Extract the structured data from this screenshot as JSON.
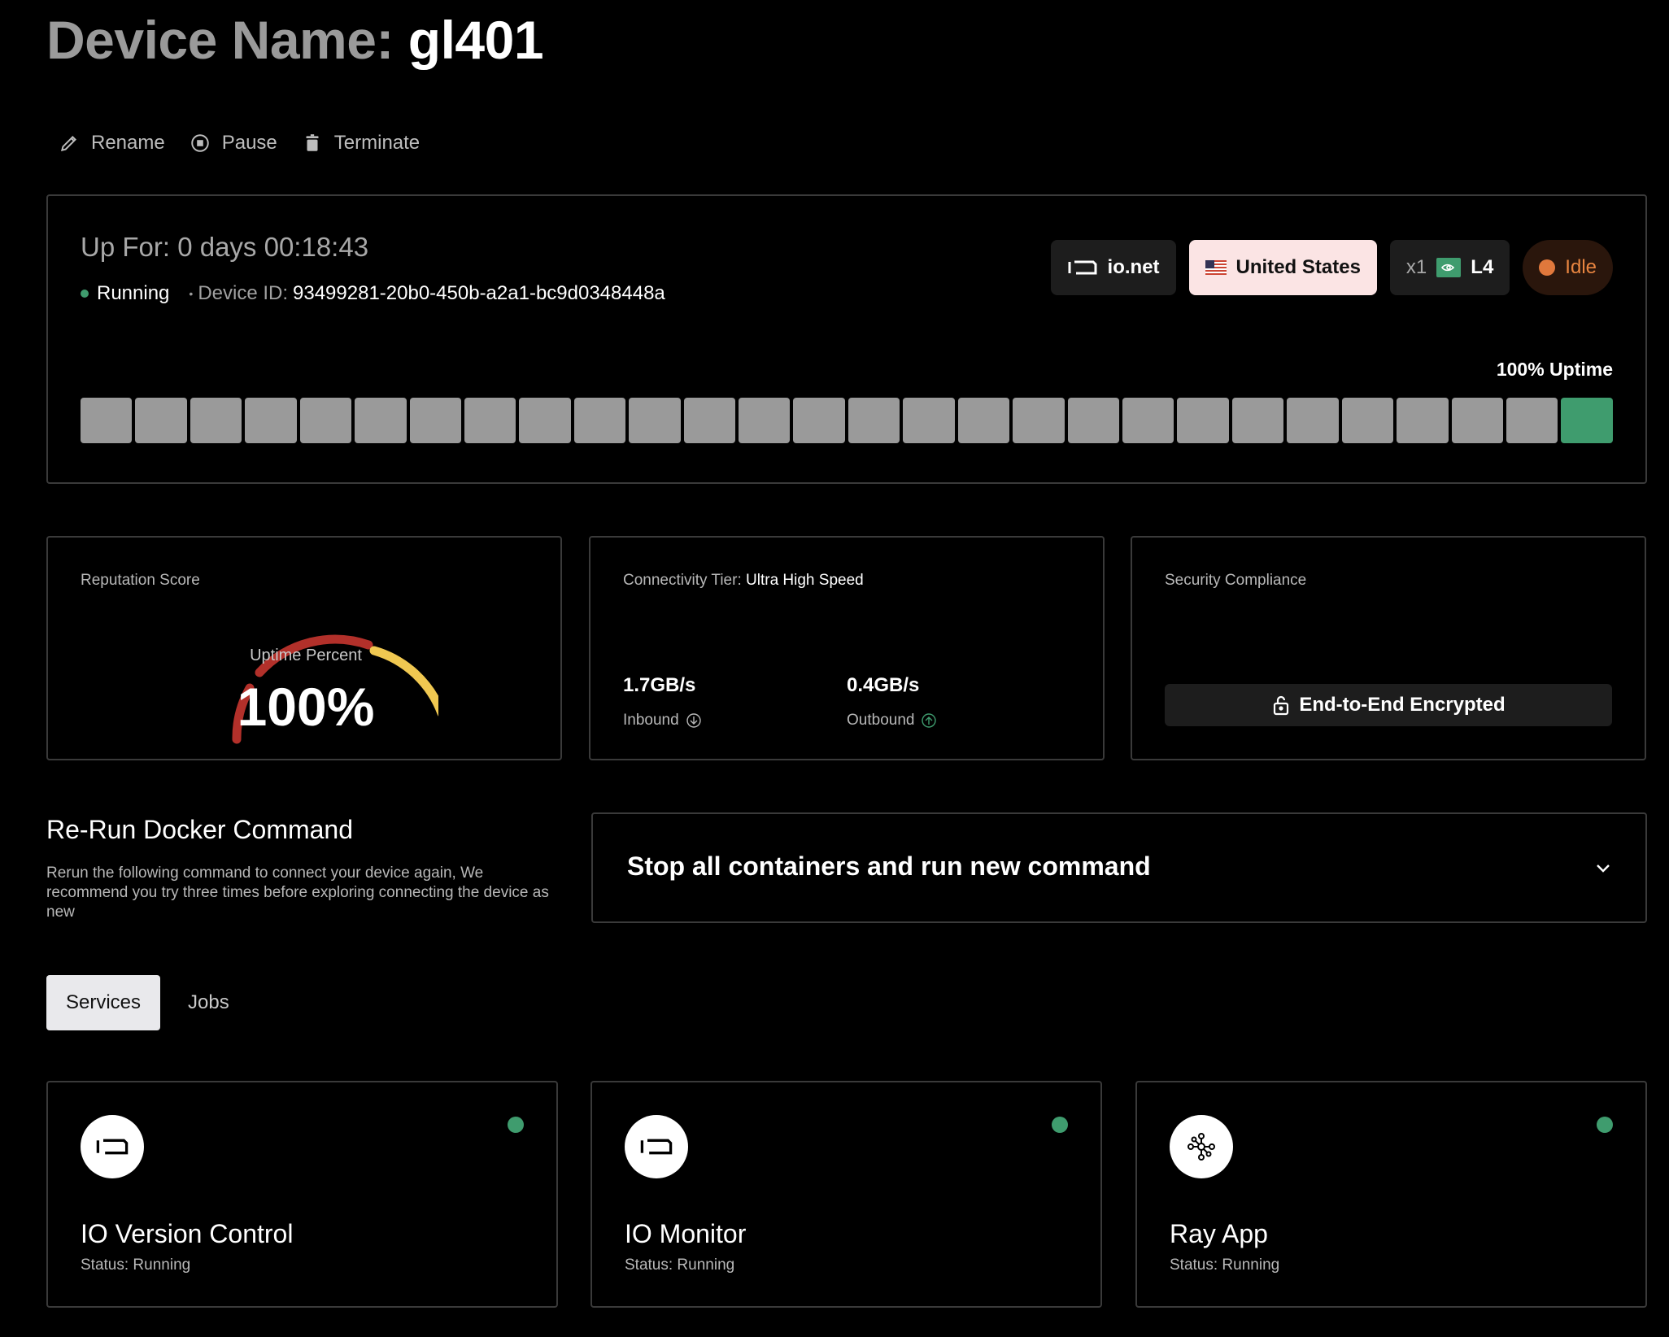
{
  "header": {
    "title_prefix": "Device Name: ",
    "device_name": "gl401"
  },
  "actions": {
    "rename": "Rename",
    "pause": "Pause",
    "terminate": "Terminate"
  },
  "uptime": {
    "up_for": "Up For: 0 days 00:18:43",
    "status": "Running",
    "device_id_label": "Device ID:",
    "device_id": "93499281-20b0-450b-a2a1-bc9d0348448a",
    "uptime_label": "100% Uptime",
    "bars_total": 28,
    "bars_active": 1
  },
  "badges": {
    "provider": "io.net",
    "country": "United States",
    "gpu_count": "x1",
    "gpu_model": "L4",
    "state": "Idle"
  },
  "reputation": {
    "label": "Reputation Score",
    "sub": "Uptime Percent",
    "value": "100%",
    "percent": 100
  },
  "connectivity": {
    "label": "Connectivity Tier:",
    "tier": "Ultra High Speed",
    "inbound_value": "1.7GB/s",
    "inbound_label": "Inbound",
    "outbound_value": "0.4GB/s",
    "outbound_label": "Outbound"
  },
  "security": {
    "label": "Security Compliance",
    "badge": "End-to-End Encrypted"
  },
  "docker": {
    "title": "Re-Run Docker Command",
    "description": "Rerun the following command to connect your device again, We recommend you try three times before exploring connecting the device as new",
    "selected": "Stop all containers and run new command"
  },
  "tabs": [
    {
      "label": "Services"
    },
    {
      "label": "Jobs"
    }
  ],
  "services": [
    {
      "name": "IO Version Control",
      "status": "Status: Running",
      "icon": "io-logo-icon"
    },
    {
      "name": "IO Monitor",
      "status": "Status: Running",
      "icon": "io-logo-icon"
    },
    {
      "name": "Ray App",
      "status": "Status: Running",
      "icon": "ray-icon"
    }
  ],
  "colors": {
    "green": "#3f9c6e",
    "orange": "#e0783c",
    "red": "#b2302a",
    "yellow": "#f0c851"
  }
}
